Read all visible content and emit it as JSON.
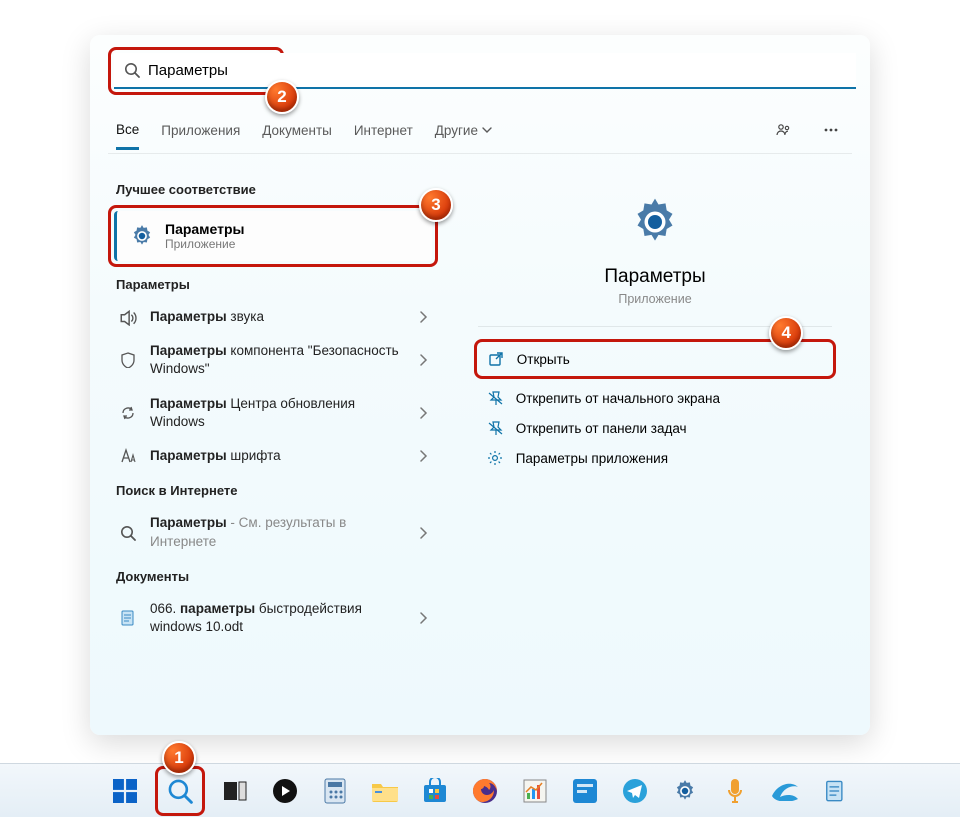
{
  "search": {
    "value": "Параметры",
    "placeholder": ""
  },
  "tabs": {
    "all": "Все",
    "apps": "Приложения",
    "docs": "Документы",
    "web": "Интернет",
    "more": "Другие"
  },
  "left": {
    "best_label": "Лучшее соответствие",
    "best": {
      "title": "Параметры",
      "sub": "Приложение"
    },
    "params_label": "Параметры",
    "items": [
      {
        "bold": "Параметры",
        "rest": " звука"
      },
      {
        "bold": "Параметры",
        "rest": " компонента \"Безопасность Windows\""
      },
      {
        "bold": "Параметры",
        "rest": " Центра обновления Windows"
      },
      {
        "bold": "Параметры",
        "rest": " шрифта"
      }
    ],
    "web_label": "Поиск в Интернете",
    "web_item": {
      "bold": "Параметры",
      "rest": " - См. результаты в Интернете"
    },
    "docs_label": "Документы",
    "doc_item": {
      "pre": "066. ",
      "bold": "параметры",
      "rest": " быстродействия windows 10.odt"
    }
  },
  "right": {
    "title": "Параметры",
    "sub": "Приложение",
    "actions": {
      "open": "Открыть",
      "unpin_start": "Открепить от начального экрана",
      "unpin_task": "Открепить от панели задач",
      "app_settings": "Параметры приложения"
    }
  },
  "badges": {
    "b1": "1",
    "b2": "2",
    "b3": "3",
    "b4": "4"
  }
}
